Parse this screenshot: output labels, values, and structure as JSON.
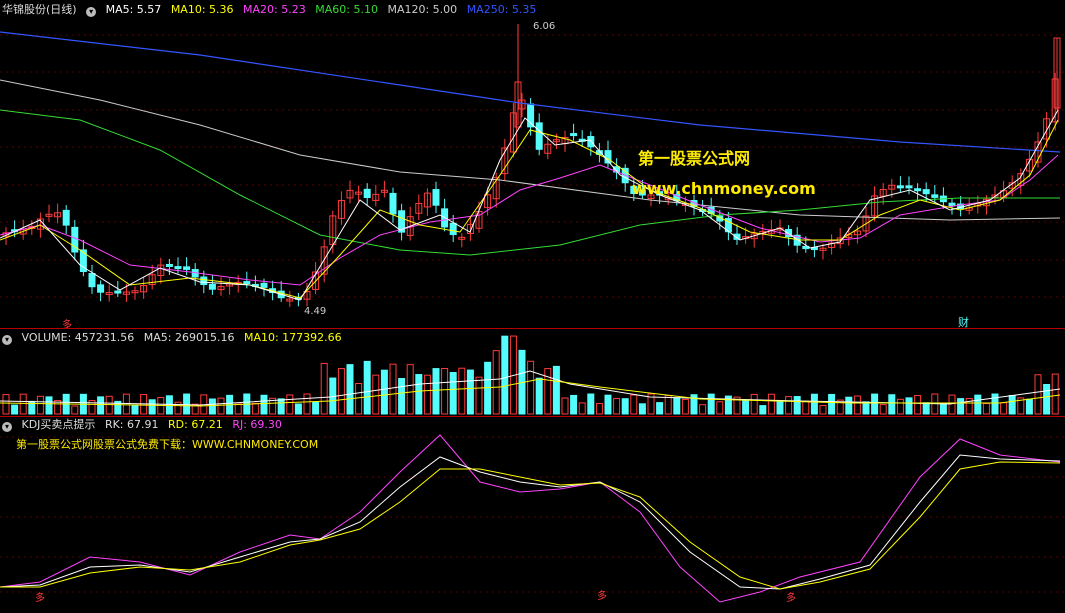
{
  "main": {
    "stock_title": "华锦股份(日线)",
    "ma": [
      {
        "label": "MA5: 5.57",
        "color": "#ffffff"
      },
      {
        "label": "MA10: 5.36",
        "color": "#ffff00"
      },
      {
        "label": "MA20: 5.23",
        "color": "#ff44ff"
      },
      {
        "label": "MA60: 5.10",
        "color": "#33dd33"
      },
      {
        "label": "MA120: 5.00",
        "color": "#cccccc"
      },
      {
        "label": "MA250: 5.35",
        "color": "#3355ff"
      }
    ],
    "high_label": "6.06",
    "low_label": "4.49",
    "buy_marker": "多",
    "fin_marker": "财",
    "watermark_title": "第一股票公式网",
    "watermark_url": "www.chnmoney.com"
  },
  "volume": {
    "label": "VOLUME: 457231.56",
    "ma5": "MA5: 269015.16",
    "ma10": "MA10: 177392.66"
  },
  "kdj": {
    "title": "KDJ买卖点提示",
    "rk": "RK: 67.91",
    "rd": "RD: 67.21",
    "rj": "RJ: 69.30",
    "promo": "第一股票公式网股票公式免费下载：WWW.CHNMONEY.COM",
    "marker1": "多",
    "marker2": "多",
    "marker3": "多"
  },
  "colors": {
    "up": "#ff3b3b",
    "down": "#54fcfc",
    "ma5": "#ffffff",
    "ma10": "#ffff00",
    "ma20": "#ff44ff",
    "ma60": "#33dd33",
    "ma120": "#cccccc",
    "ma250": "#3355ff"
  }
}
